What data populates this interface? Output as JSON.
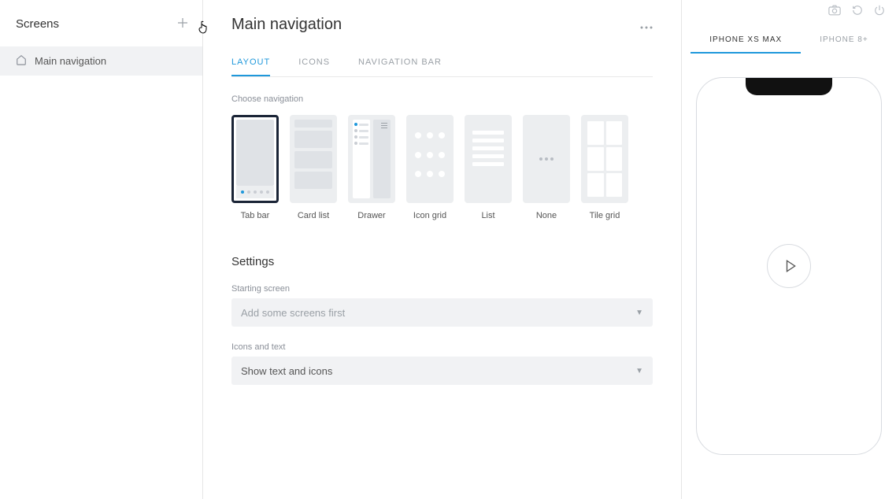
{
  "sidebar": {
    "title": "Screens",
    "items": [
      {
        "label": "Main navigation"
      }
    ]
  },
  "main": {
    "title": "Main navigation",
    "tabs": [
      {
        "label": "LAYOUT",
        "active": true
      },
      {
        "label": "ICONS",
        "active": false
      },
      {
        "label": "NAVIGATION BAR",
        "active": false
      }
    ],
    "choose_nav_label": "Choose navigation",
    "nav_options": [
      {
        "label": "Tab bar",
        "type": "tabbar",
        "selected": true
      },
      {
        "label": "Card list",
        "type": "cardlist",
        "selected": false
      },
      {
        "label": "Drawer",
        "type": "drawer",
        "selected": false
      },
      {
        "label": "Icon grid",
        "type": "icongrid",
        "selected": false
      },
      {
        "label": "List",
        "type": "list",
        "selected": false
      },
      {
        "label": "None",
        "type": "none",
        "selected": false
      },
      {
        "label": "Tile grid",
        "type": "tilegrid",
        "selected": false
      }
    ],
    "settings": {
      "heading": "Settings",
      "starting_screen_label": "Starting screen",
      "starting_screen_value": "Add some screens first",
      "icons_text_label": "Icons and text",
      "icons_text_value": "Show text and icons"
    }
  },
  "preview": {
    "device_tabs": [
      {
        "label": "IPHONE XS MAX",
        "active": true
      },
      {
        "label": "IPHONE 8+",
        "active": false
      }
    ]
  }
}
